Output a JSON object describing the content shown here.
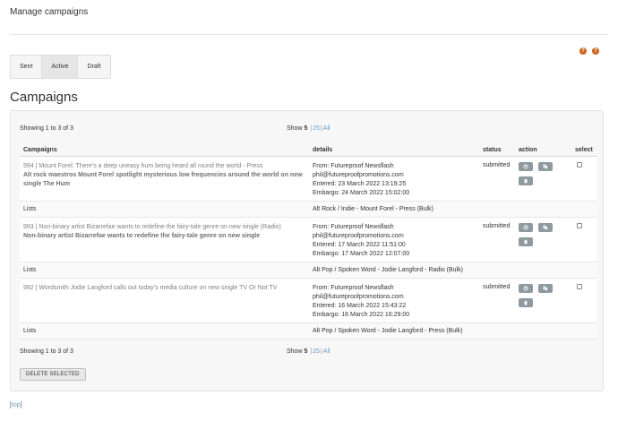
{
  "page": {
    "title": "Manage campaigns",
    "section_title": "Campaigns",
    "top_link_open": "[",
    "top_link_text": "top",
    "top_link_close": "]"
  },
  "help_icons": [
    "?",
    "?"
  ],
  "tabs": [
    {
      "label": "Sent"
    },
    {
      "label": "Active"
    },
    {
      "label": "Draft"
    }
  ],
  "pager": {
    "showing": "Showing 1 to 3 of 3",
    "show_label": "Show",
    "opt_5": "5",
    "opt_25": "25",
    "opt_all": "All",
    "sep": "|"
  },
  "table": {
    "headers": {
      "campaigns": "Campaigns",
      "details": "details",
      "status": "status",
      "action": "action",
      "select": "select"
    },
    "lists_label": "Lists",
    "rows": [
      {
        "title": "994 | Mount Forel: There’s a deep uneasy hum being heard all round the world - Press",
        "subtitle": "Alt rock maestros Mount Forel spotlight mysterious low frequencies around the world on new single The Hum",
        "from": "From: Futureproof Newsflash",
        "email": "phil@futureproofpromotions.com",
        "entered": "Entered: 23 March 2022 13:19:25",
        "embargo": "Embargo: 24 March 2022 15:02:00",
        "status": "submitted",
        "lists": "Alt Rock / Indie - Mount Forel - Press (Bulk)"
      },
      {
        "title": "993 | Non-binary artist Bizarrefae wants to redefine the fairy-tale genre on new single (Radio)",
        "subtitle": "Non-binary artist Bizarrefae wants to redefine the fairy-tale genre on new single",
        "from": "From: Futureproof Newsflash",
        "email": "phil@futureproofpromotions.com",
        "entered": "Entered: 17 March 2022 11:51:00",
        "embargo": "Embargo: 17 March 2022 12:07:00",
        "status": "submitted",
        "lists": "Alt Pop / Spoken Word - Jodie Langford - Radio (Bulk)"
      },
      {
        "title": "992 | Wordsmith Jodie Langford calls out today’s media culture on new single TV Or Not TV",
        "subtitle": "",
        "from": "From: Futureproof Newsflash",
        "email": "phil@futureproofpromotions.com",
        "entered": "Entered: 16 March 2022 15:43:22",
        "embargo": "Embargo: 16 March 2022 16:29:00",
        "status": "submitted",
        "lists": "Alt Pop / Spoken Word - Jodie Langford - Press (Bulk)"
      }
    ]
  },
  "delete_label": "DELETE SELECTED",
  "colors": {
    "accent": "#d0641c",
    "link": "#6a9ec8",
    "action_button": "#8e9aa0"
  }
}
